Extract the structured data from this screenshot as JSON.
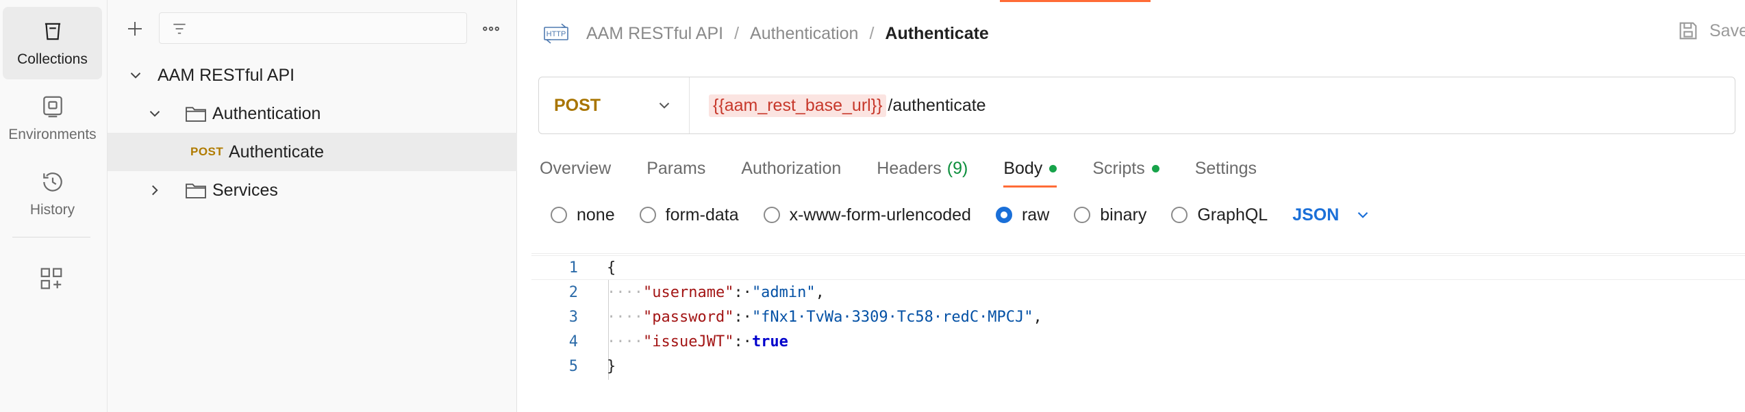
{
  "rail": {
    "items": [
      {
        "label": "Collections",
        "icon": "collections-icon",
        "active": true
      },
      {
        "label": "Environments",
        "icon": "environments-icon",
        "active": false
      },
      {
        "label": "History",
        "icon": "history-icon",
        "active": false
      }
    ],
    "extra_icon": "add-workspace-grid-icon"
  },
  "sidebar": {
    "tree": [
      {
        "label": "AAM RESTful API",
        "level": 0,
        "expanded": true
      },
      {
        "label": "Authentication",
        "level": 1,
        "expanded": true,
        "type": "folder"
      },
      {
        "method": "POST",
        "label": "Authenticate",
        "level": 2,
        "selected": true
      },
      {
        "label": "Services",
        "level": 1,
        "expanded": false,
        "type": "folder"
      }
    ]
  },
  "header": {
    "breadcrumb": [
      "AAM RESTful API",
      "Authentication"
    ],
    "current": "Authenticate",
    "save_label": "Save",
    "separator": "/"
  },
  "request": {
    "method": "POST",
    "url_variable": "{{aam_rest_base_url}}",
    "url_path": "/authenticate"
  },
  "tabs": [
    {
      "label": "Overview"
    },
    {
      "label": "Params"
    },
    {
      "label": "Authorization"
    },
    {
      "label": "Headers",
      "count": "(9)"
    },
    {
      "label": "Body",
      "dot": true,
      "active": true
    },
    {
      "label": "Scripts",
      "dot": true
    },
    {
      "label": "Settings"
    }
  ],
  "body_options": {
    "modes": [
      "none",
      "form-data",
      "x-www-form-urlencoded",
      "raw",
      "binary",
      "GraphQL"
    ],
    "selected": "raw",
    "language": "JSON"
  },
  "editor": {
    "line_numbers": [
      "1",
      "2",
      "3",
      "4",
      "5"
    ],
    "open_brace": "{",
    "close_brace": "}",
    "indent": "····",
    "fields": [
      {
        "key": "\"username\"",
        "colon": ":·",
        "value": "\"admin\"",
        "comma": ","
      },
      {
        "key": "\"password\"",
        "colon": ":·",
        "value": "\"fNx1·TvWa·3309·Tc58·redC·MPCJ\"",
        "comma": ","
      },
      {
        "key": "\"issueJWT\"",
        "colon": ":·",
        "value": "true",
        "comma": ""
      }
    ]
  },
  "colors": {
    "accent": "#ff6c37",
    "method_post": "#a87400",
    "url_variable_bg": "#fbe4e1",
    "url_variable_text": "#c7382b",
    "radio_selected": "#1a6fd8",
    "status_dot": "#17a34a"
  }
}
